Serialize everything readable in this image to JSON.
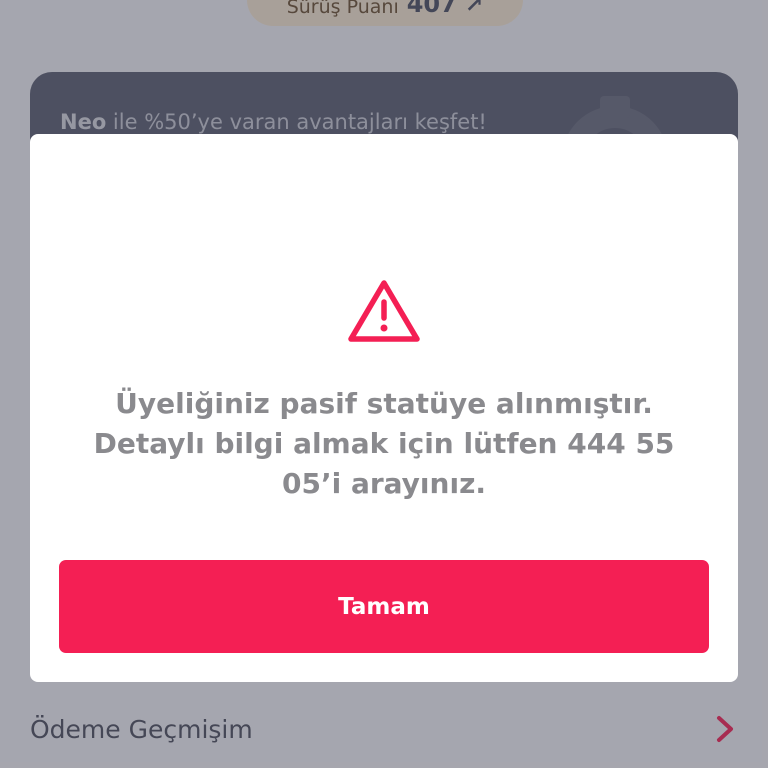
{
  "score": {
    "label": "Sürüş Puanı",
    "value": "407",
    "arrow_icon": "arrow-up-right-icon"
  },
  "promo": {
    "brand": "Neo",
    "text": " ile %50’ye varan avantajları keşfet!",
    "icon": "gear-icon"
  },
  "list": {
    "payment_history_label": "Ödeme Geçmişim",
    "chevron_icon": "chevron-right-icon"
  },
  "modal": {
    "icon": "warning-triangle-icon",
    "message": "Üyeliğiniz pasif statüye alınmıştır. Detaylı bilgi almak için lütfen 444 55 05’i arayınız.",
    "button_label": "Tamam"
  },
  "colors": {
    "accent": "#f41f54",
    "card": "#5b5e6f",
    "score_pill": "#f6e7cf"
  }
}
